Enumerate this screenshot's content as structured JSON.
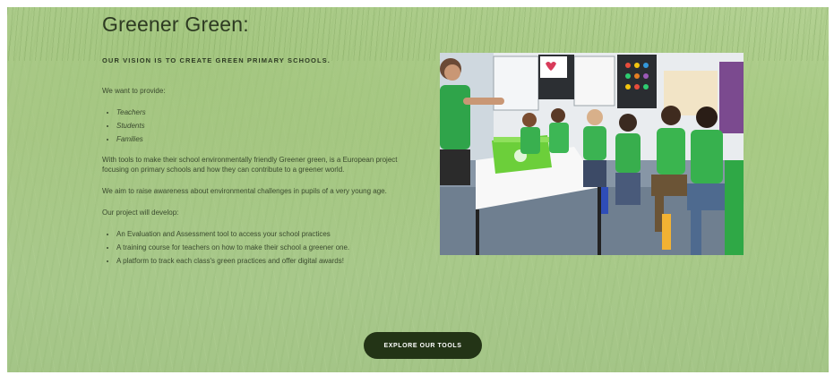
{
  "section": {
    "title": "Greener Green:",
    "vision": "OUR VISION IS TO CREATE GREEN PRIMARY SCHOOLS.",
    "provide_intro": "We want to provide:",
    "provide_items": [
      "Teachers",
      "Students",
      "Families"
    ],
    "paragraph1": "With tools to make their school environmentally friendly Greener green, is a European project focusing on primary schools and how they can contribute to a greener world.",
    "paragraph2": "We aim to raise awareness about environmental challenges in pupils of a very young age.",
    "develop_intro": "Our project will develop:",
    "develop_items": [
      "An Evaluation and Assessment tool to access your school practices",
      "A training course for teachers on how to make their school a greener one.",
      "A platform to track each class's green practices and offer digital awards!"
    ]
  },
  "cta": {
    "label": "EXPLORE OUR TOOLS"
  },
  "colors": {
    "background": "#aecb8e",
    "button": "#233416",
    "shirt_green": "#3fb04f",
    "text": "#3a4a2e"
  }
}
